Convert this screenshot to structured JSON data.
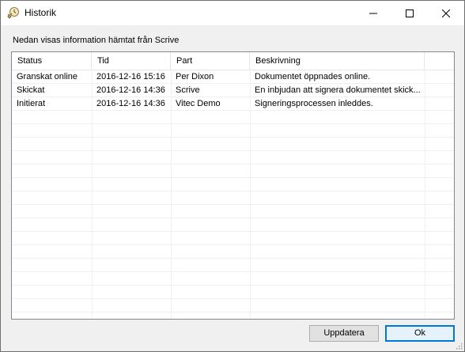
{
  "window": {
    "title": "Historik",
    "icon": "app-history-icon"
  },
  "titlebar_buttons": {
    "minimize": "minimize-icon",
    "maximize": "maximize-icon",
    "close": "close-icon"
  },
  "info_label": "Nedan visas information hämtat från Scrive",
  "table": {
    "columns": [
      "Status",
      "Tid",
      "Part",
      "Beskrivning"
    ],
    "rows": [
      [
        "Granskat online",
        "2016-12-16 15:16",
        "Per Dixon",
        "Dokumentet öppnades online."
      ],
      [
        "Skickat",
        "2016-12-16 14:36",
        "Scrive",
        "En inbjudan att signera dokumentet skick..."
      ],
      [
        "Initierat",
        "2016-12-16 14:36",
        "Vitec Demo",
        "Signeringsprocessen inleddes."
      ]
    ]
  },
  "buttons": {
    "update": "Uppdatera",
    "ok": "Ok"
  },
  "colors": {
    "accent": "#0078d7",
    "window_bg": "#f0f0f0",
    "list_bg": "#ffffff",
    "border": "#828790"
  }
}
